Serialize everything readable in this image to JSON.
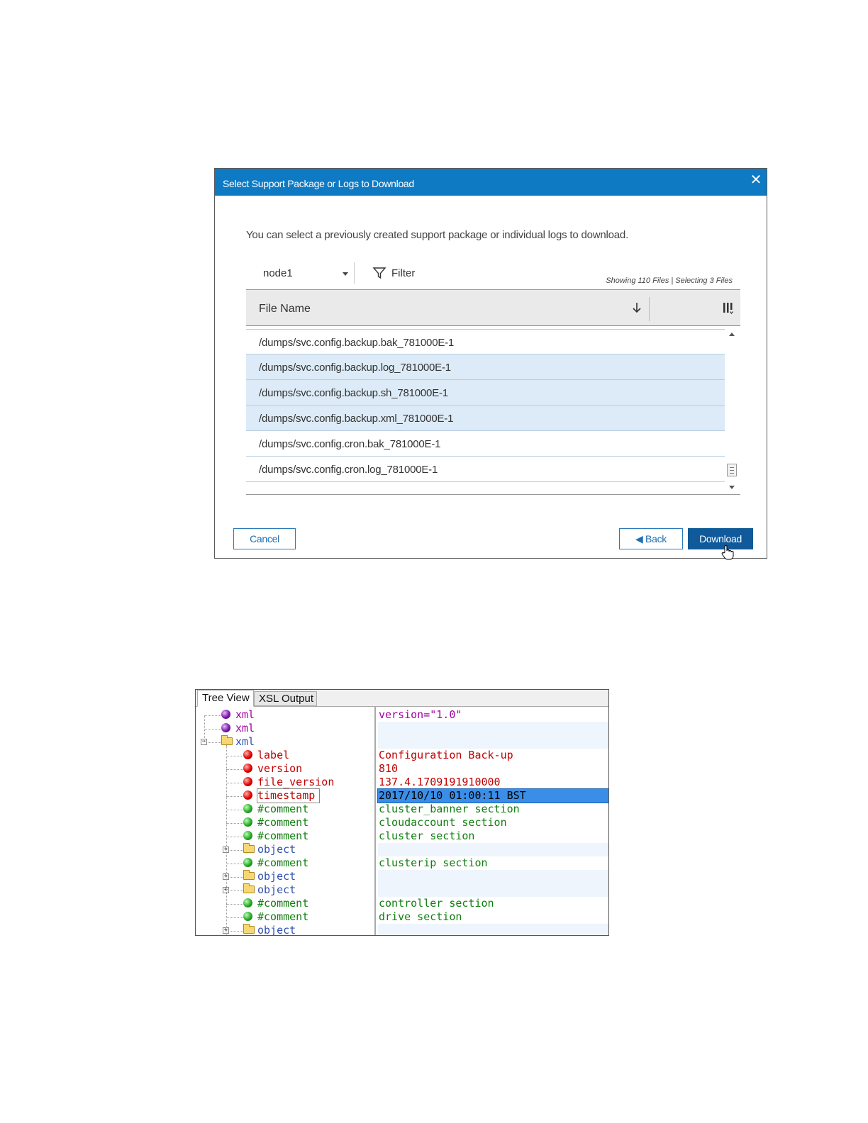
{
  "dialog": {
    "title": "Select Support Package or Logs to Download",
    "close_label": "✕",
    "description": "You can select a previously created support package or individual logs to download.",
    "node_select": "node1",
    "filter_label": "Filter",
    "counts": "Showing 110 Files | Selecting 3 Files",
    "column_header": "File Name",
    "rows": [
      {
        "name": "/dumps/svc.config.backup.bak_781000E-1",
        "selected": false
      },
      {
        "name": "/dumps/svc.config.backup.log_781000E-1",
        "selected": true
      },
      {
        "name": "/dumps/svc.config.backup.sh_781000E-1",
        "selected": true
      },
      {
        "name": "/dumps/svc.config.backup.xml_781000E-1",
        "selected": true
      },
      {
        "name": "/dumps/svc.config.cron.bak_781000E-1",
        "selected": false
      },
      {
        "name": "/dumps/svc.config.cron.log_781000E-1",
        "selected": false
      }
    ],
    "buttons": {
      "cancel": "Cancel",
      "back": "◀ Back",
      "download": "Download"
    },
    "colors": {
      "header": "#0f7ac4",
      "primary_button": "#10599a",
      "selected_row": "#dcebf7"
    }
  },
  "xml_viewer": {
    "tabs": [
      "Tree View",
      "XSL Output"
    ],
    "active_tab": "Tree View",
    "nodes": [
      {
        "label": "xml",
        "kind": "pi",
        "value": "version=\"1.0\""
      },
      {
        "label": "xml",
        "kind": "pi",
        "value": ""
      },
      {
        "label": "xml",
        "kind": "folder",
        "value": ""
      },
      {
        "label": "label",
        "kind": "el",
        "value": "Configuration Back-up"
      },
      {
        "label": "version",
        "kind": "el",
        "value": "810"
      },
      {
        "label": "file_version",
        "kind": "el",
        "value": "137.4.1709191910000"
      },
      {
        "label": "timestamp",
        "kind": "el",
        "value": "2017/10/10 01:00:11 BST"
      },
      {
        "label": "#comment",
        "kind": "cm",
        "value": "cluster_banner section"
      },
      {
        "label": "#comment",
        "kind": "cm",
        "value": "cloudaccount section"
      },
      {
        "label": "#comment",
        "kind": "cm",
        "value": "cluster section"
      },
      {
        "label": "object",
        "kind": "obj",
        "value": ""
      },
      {
        "label": "#comment",
        "kind": "cm",
        "value": "clusterip section"
      },
      {
        "label": "object",
        "kind": "obj",
        "value": ""
      },
      {
        "label": "object",
        "kind": "obj",
        "value": ""
      },
      {
        "label": "#comment",
        "kind": "cm",
        "value": "controller section"
      },
      {
        "label": "#comment",
        "kind": "cm",
        "value": "drive section"
      },
      {
        "label": "object",
        "kind": "obj",
        "value": ""
      }
    ],
    "highlighted_node": "timestamp"
  }
}
